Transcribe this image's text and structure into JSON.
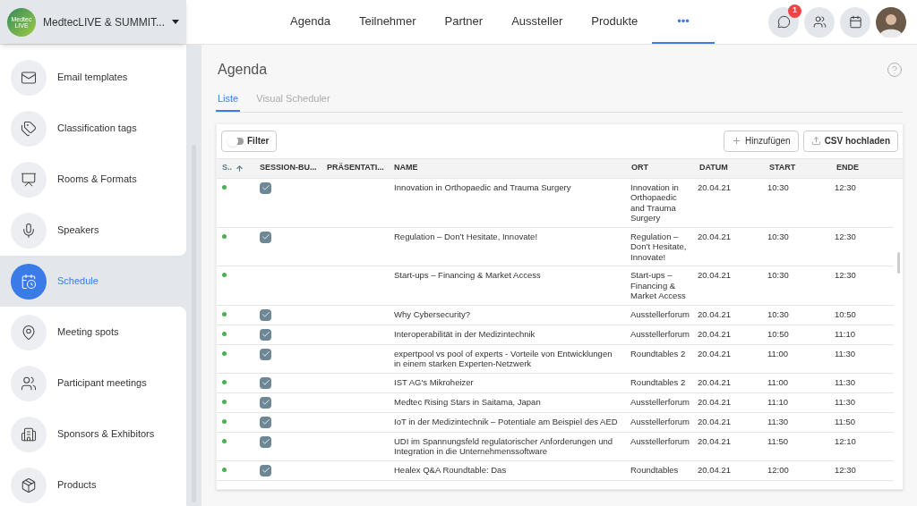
{
  "event": {
    "logo_lines": [
      "Medtec",
      "LIVE"
    ],
    "name": "MedtecLIVE & SUMMIT..."
  },
  "sidebar": {
    "items": [
      {
        "label": "Email templates",
        "kind": "mail",
        "selected": false
      },
      {
        "label": "Classification tags",
        "kind": "tags",
        "selected": false
      },
      {
        "label": "Rooms & Formats",
        "kind": "rooms",
        "selected": false
      },
      {
        "label": "Speakers",
        "kind": "speaker",
        "selected": false
      },
      {
        "label": "Schedule",
        "kind": "schedule",
        "selected": true
      },
      {
        "label": "Meeting spots",
        "kind": "spot",
        "selected": false
      },
      {
        "label": "Participant meetings",
        "kind": "meet",
        "selected": false
      },
      {
        "label": "Sponsors & Exhibitors",
        "kind": "sponsor",
        "selected": false
      },
      {
        "label": "Products",
        "kind": "product",
        "selected": false
      }
    ]
  },
  "nav": {
    "tabs": [
      {
        "label": "Agenda",
        "selected": false
      },
      {
        "label": "Teilnehmer",
        "selected": false
      },
      {
        "label": "Partner",
        "selected": false
      },
      {
        "label": "Aussteller",
        "selected": false
      },
      {
        "label": "Produkte",
        "selected": false
      },
      {
        "label": "•••",
        "selected": true
      }
    ],
    "chat_badge": "1"
  },
  "page": {
    "title": "Agenda",
    "subtabs": [
      {
        "label": "Liste",
        "selected": true
      },
      {
        "label": "Visual Scheduler",
        "selected": false
      }
    ]
  },
  "toolbar": {
    "filter": {
      "label": "Filter",
      "on": false
    },
    "add_button": "Hinzufügen",
    "upload_button": "CSV hochladen"
  },
  "table": {
    "columns": [
      {
        "label": "S..",
        "sorted": true
      },
      {
        "label": "SESSION-BU...",
        "sorted": false
      },
      {
        "label": "PRÄSENTATI...",
        "sorted": false
      },
      {
        "label": "NAME",
        "sorted": false
      },
      {
        "label": "ORT",
        "sorted": false
      },
      {
        "label": "DATUM",
        "sorted": false
      },
      {
        "label": "START",
        "sorted": false
      },
      {
        "label": "ENDE",
        "sorted": false
      }
    ],
    "rows": [
      {
        "color": "#4caf50",
        "checked": true,
        "name": "Innovation in Orthopaedic and Trauma Surgery",
        "ort": "Innovation in Orthopaedic and Trauma Surgery",
        "datum": "20.04.21",
        "start": "10:30",
        "ende": "12:30"
      },
      {
        "color": "#4caf50",
        "checked": true,
        "name": "Regulation – Don’t Hesitate, Innovate!",
        "ort": "Regulation – Don’t Hesitate, Innovate!",
        "datum": "20.04.21",
        "start": "10:30",
        "ende": "12:30"
      },
      {
        "color": "#4caf50",
        "checked": false,
        "name": "Start-ups – Financing & Market Access",
        "ort": "Start-ups – Financing & Market Access",
        "datum": "20.04.21",
        "start": "10:30",
        "ende": "12:30"
      },
      {
        "color": "#4caf50",
        "checked": true,
        "name": "Why Cybersecurity?",
        "ort": "Ausstellerforum",
        "datum": "20.04.21",
        "start": "10:30",
        "ende": "10:50"
      },
      {
        "color": "#4caf50",
        "checked": true,
        "name": "Interoperabilität in der Medizintechnik",
        "ort": "Ausstellerforum",
        "datum": "20.04.21",
        "start": "10:50",
        "ende": "11:10"
      },
      {
        "color": "#4caf50",
        "checked": true,
        "name": "expertpool vs pool of experts - Vorteile von Entwicklungen in einem starken Experten-Netzwerk",
        "ort": "Roundtables 2",
        "datum": "20.04.21",
        "start": "11:00",
        "ende": "11:30"
      },
      {
        "color": "#4caf50",
        "checked": true,
        "name": "IST AG's Mikroheizer",
        "ort": "Roundtables 2",
        "datum": "20.04.21",
        "start": "11:00",
        "ende": "11:30"
      },
      {
        "color": "#4caf50",
        "checked": true,
        "name": "Medtec Rising Stars in Saitama, Japan",
        "ort": "Ausstellerforum",
        "datum": "20.04.21",
        "start": "11:10",
        "ende": "11:30"
      },
      {
        "color": "#4caf50",
        "checked": true,
        "name": "IoT in der Medizintechnik – Potentiale am Beispiel des AED",
        "ort": "Ausstellerforum",
        "datum": "20.04.21",
        "start": "11:30",
        "ende": "11:50"
      },
      {
        "color": "#4caf50",
        "checked": true,
        "name": "UDI im Spannungsfeld regulatorischer Anforderungen und Integration in die Unternehmenssoftware",
        "ort": "Ausstellerforum",
        "datum": "20.04.21",
        "start": "11:50",
        "ende": "12:10"
      },
      {
        "color": "#4caf50",
        "checked": true,
        "name": "Healex Q&A Roundtable: Das",
        "ort": "Roundtables",
        "datum": "20.04.21",
        "start": "12:00",
        "ende": "12:30"
      }
    ]
  }
}
